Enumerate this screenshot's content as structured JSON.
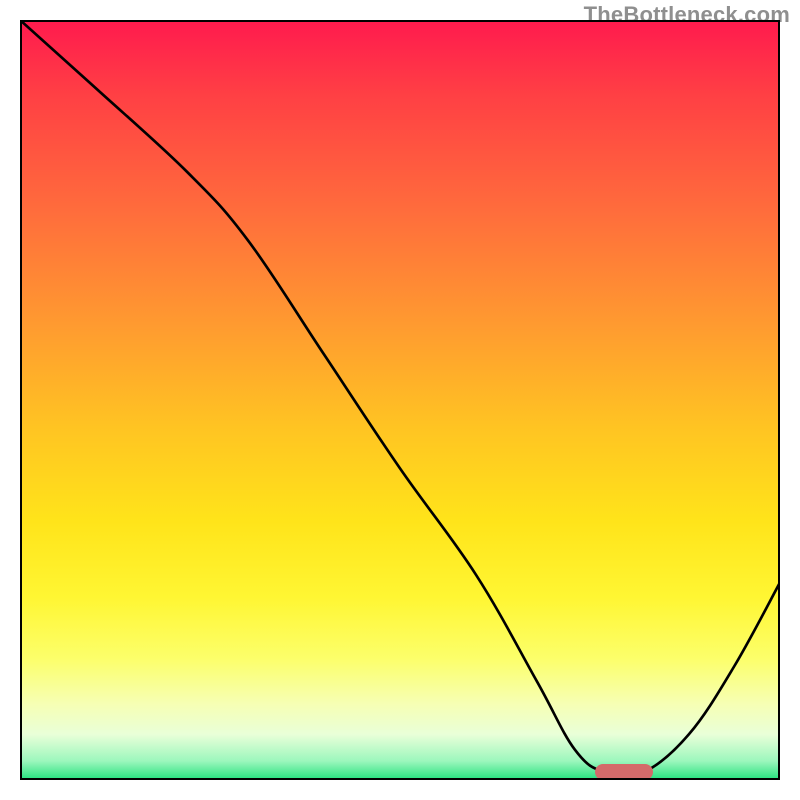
{
  "attribution": "TheBottleneck.com",
  "colors": {
    "gradient_top": "#ff1a4e",
    "gradient_bottom": "#22e07c",
    "curve": "#000000",
    "frame": "#000000",
    "marker": "#d46a6a"
  },
  "chart_data": {
    "type": "line",
    "title": "",
    "xlabel": "",
    "ylabel": "",
    "xlim": [
      0,
      100
    ],
    "ylim": [
      0,
      100
    ],
    "grid": false,
    "legend": false,
    "series": [
      {
        "name": "bottleneck-curve",
        "x": [
          0,
          10,
          22,
          30,
          40,
          50,
          60,
          68,
          73,
          77,
          82,
          88,
          94,
          100
        ],
        "values": [
          100,
          91,
          80,
          71,
          56,
          41,
          27,
          13,
          4,
          1,
          1,
          6,
          15,
          26
        ]
      }
    ],
    "marker": {
      "x_center": 79.5,
      "y": 1,
      "width_pct": 7.6
    }
  }
}
